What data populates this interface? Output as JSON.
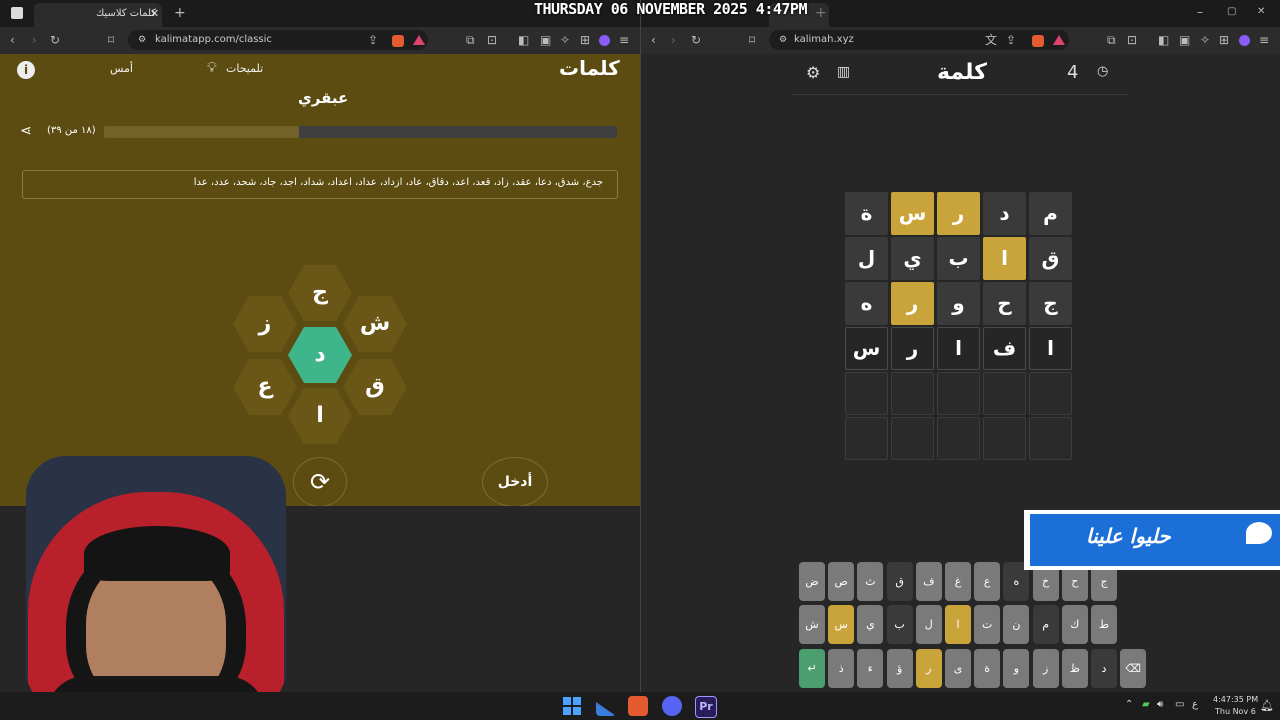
{
  "overlay": {
    "datetime": "THURSDAY 06 NOVEMBER 2025 4:47PM",
    "badge": "حليوا علينا"
  },
  "left_browser": {
    "tab_title": "كلمات كلاسيك",
    "url": "kalimatapp.com/classic",
    "game": {
      "logo": "كلمات",
      "hints_label": "تلميحات",
      "yesterday_label": "أمس",
      "rank": "عبقري",
      "progress_text": "(١٨ من ٣٩)",
      "progress_fraction": 0.62,
      "found_words": "جدع، شدق، دعا، عقد، زاد، قعد، اعد، دقاق، عاد، ازداد، عداد، اعداد، شداد، اجد، جاد، شحد، عدد، عدا",
      "letters": {
        "top": "ج",
        "top_right": "ش",
        "bottom_right": "ق",
        "bottom": "ا",
        "bottom_left": "ع",
        "top_left": "ز",
        "center": "د"
      },
      "enter_label": "أدخل"
    }
  },
  "right_browser": {
    "tab_title": "",
    "url": "kalimah.xyz",
    "game": {
      "title": "كلمة",
      "counter": "4",
      "grid": [
        [
          {
            "l": "ة",
            "s": "d"
          },
          {
            "l": "س",
            "s": "y"
          },
          {
            "l": "ر",
            "s": "y"
          },
          {
            "l": "د",
            "s": "d"
          },
          {
            "l": "م",
            "s": "d"
          }
        ],
        [
          {
            "l": "ل",
            "s": "d"
          },
          {
            "l": "ي",
            "s": "d"
          },
          {
            "l": "ب",
            "s": "d"
          },
          {
            "l": "ا",
            "s": "y"
          },
          {
            "l": "ق",
            "s": "d"
          }
        ],
        [
          {
            "l": "ه",
            "s": "d"
          },
          {
            "l": "ر",
            "s": "y"
          },
          {
            "l": "و",
            "s": "d"
          },
          {
            "l": "ح",
            "s": "d"
          },
          {
            "l": "ج",
            "s": "d"
          }
        ],
        [
          {
            "l": "س",
            "s": "o"
          },
          {
            "l": "ر",
            "s": "o"
          },
          {
            "l": "ا",
            "s": "o"
          },
          {
            "l": "ف",
            "s": "o"
          },
          {
            "l": "ا",
            "s": "o"
          }
        ],
        [
          {
            "l": "",
            "s": "e"
          },
          {
            "l": "",
            "s": "e"
          },
          {
            "l": "",
            "s": "e"
          },
          {
            "l": "",
            "s": "e"
          },
          {
            "l": "",
            "s": "e"
          }
        ],
        [
          {
            "l": "",
            "s": "e"
          },
          {
            "l": "",
            "s": "e"
          },
          {
            "l": "",
            "s": "e"
          },
          {
            "l": "",
            "s": "e"
          },
          {
            "l": "",
            "s": "e"
          }
        ]
      ],
      "keyboard": [
        [
          {
            "l": "ض",
            "s": "n"
          },
          {
            "l": "ص",
            "s": "n"
          },
          {
            "l": "ث",
            "s": "n"
          },
          {
            "l": "ق",
            "s": "d"
          },
          {
            "l": "ف",
            "s": "n"
          },
          {
            "l": "غ",
            "s": "n"
          },
          {
            "l": "ع",
            "s": "n"
          },
          {
            "l": "ه",
            "s": "d"
          },
          {
            "l": "خ",
            "s": "n"
          },
          {
            "l": "ح",
            "s": "n"
          },
          {
            "l": "ج",
            "s": "n"
          }
        ],
        [
          {
            "l": "ش",
            "s": "n"
          },
          {
            "l": "س",
            "s": "y"
          },
          {
            "l": "ي",
            "s": "n"
          },
          {
            "l": "ب",
            "s": "d"
          },
          {
            "l": "ل",
            "s": "n"
          },
          {
            "l": "ا",
            "s": "y"
          },
          {
            "l": "ت",
            "s": "n"
          },
          {
            "l": "ن",
            "s": "n"
          },
          {
            "l": "م",
            "s": "d"
          },
          {
            "l": "ك",
            "s": "n"
          },
          {
            "l": "ط",
            "s": "n"
          }
        ],
        [
          {
            "l": "↵",
            "s": "g"
          },
          {
            "l": "ذ",
            "s": "n"
          },
          {
            "l": "ء",
            "s": "n"
          },
          {
            "l": "ؤ",
            "s": "n"
          },
          {
            "l": "ر",
            "s": "y"
          },
          {
            "l": "ى",
            "s": "n"
          },
          {
            "l": "ة",
            "s": "n"
          },
          {
            "l": "و",
            "s": "n"
          },
          {
            "l": "ز",
            "s": "n"
          },
          {
            "l": "ظ",
            "s": "n"
          },
          {
            "l": "د",
            "s": "d"
          },
          {
            "l": "⌫",
            "s": "n"
          }
        ]
      ]
    }
  },
  "taskbar": {
    "time": "4:47:35 PM",
    "date": "Thu Nov 6",
    "lang": "ع"
  }
}
